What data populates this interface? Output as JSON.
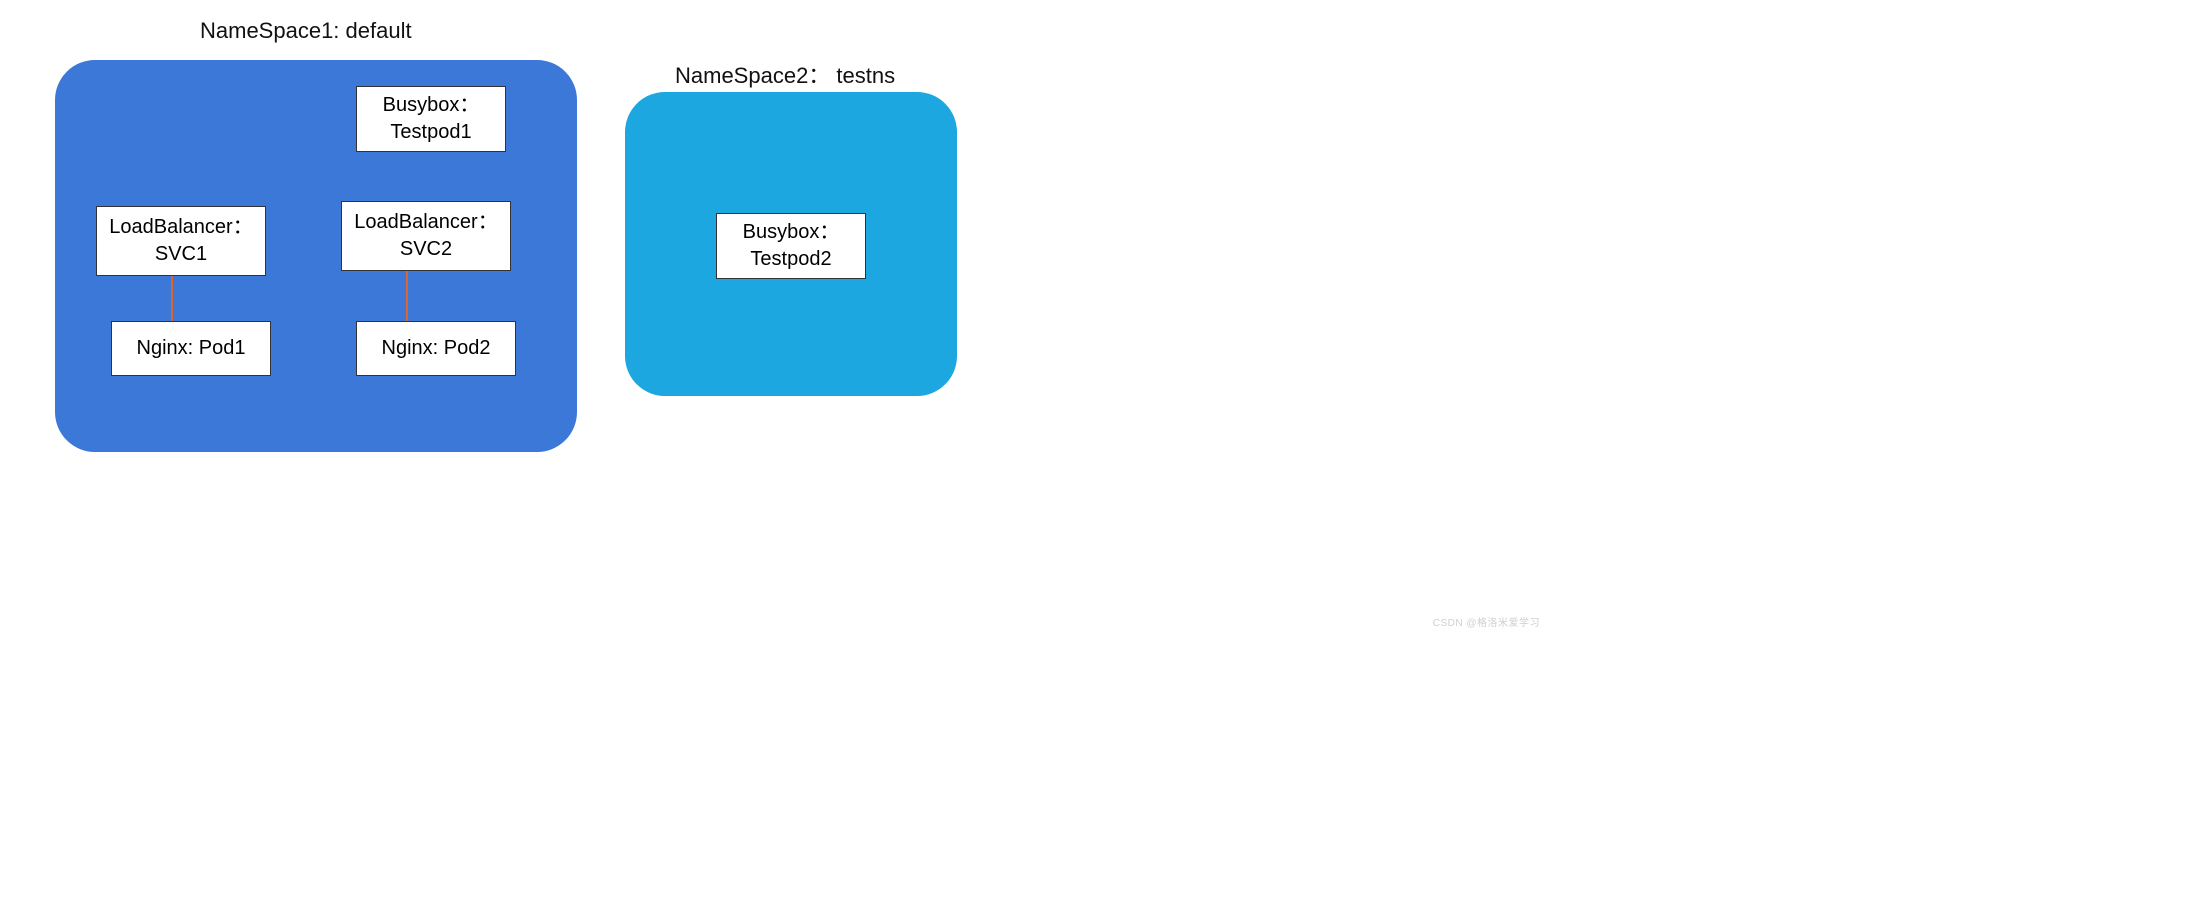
{
  "namespace1": {
    "title": "NameSpace1: default",
    "busybox": {
      "line1": "Busybox：",
      "line2": "Testpod1"
    },
    "svc1": {
      "line1": "LoadBalancer：",
      "line2": "SVC1"
    },
    "svc2": {
      "line1": "LoadBalancer：",
      "line2": "SVC2"
    },
    "pod1": {
      "line1": "Nginx: Pod1"
    },
    "pod2": {
      "line1": "Nginx: Pod2"
    }
  },
  "namespace2": {
    "title": "NameSpace2： testns",
    "busybox": {
      "line1": "Busybox：",
      "line2": "Testpod2"
    }
  },
  "watermark": "CSDN @格洛米爱学习",
  "chart_data": {
    "type": "diagram",
    "nodes": [
      {
        "id": "ns1",
        "type": "namespace",
        "label": "NameSpace1: default"
      },
      {
        "id": "ns2",
        "type": "namespace",
        "label": "NameSpace2： testns"
      },
      {
        "id": "testpod1",
        "type": "pod",
        "label": "Busybox：Testpod1",
        "parent": "ns1"
      },
      {
        "id": "svc1",
        "type": "service",
        "label": "LoadBalancer：SVC1",
        "parent": "ns1"
      },
      {
        "id": "svc2",
        "type": "service",
        "label": "LoadBalancer：SVC2",
        "parent": "ns1"
      },
      {
        "id": "pod1",
        "type": "pod",
        "label": "Nginx: Pod1",
        "parent": "ns1"
      },
      {
        "id": "pod2",
        "type": "pod",
        "label": "Nginx: Pod2",
        "parent": "ns1"
      },
      {
        "id": "testpod2",
        "type": "pod",
        "label": "Busybox：Testpod2",
        "parent": "ns2"
      }
    ],
    "edges": [
      {
        "from": "svc1",
        "to": "pod1"
      },
      {
        "from": "svc2",
        "to": "pod2"
      }
    ]
  }
}
